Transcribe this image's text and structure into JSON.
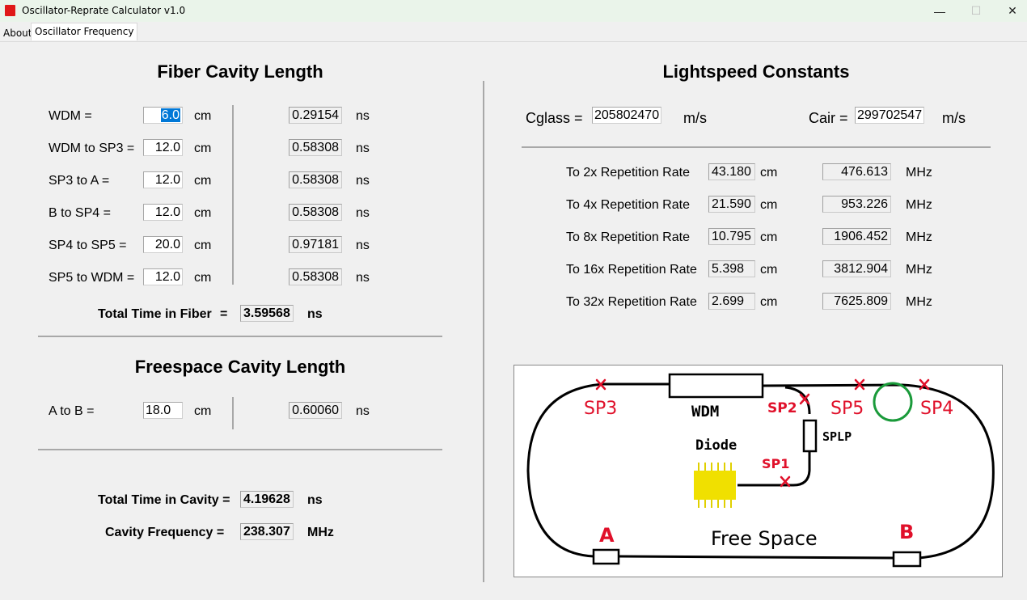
{
  "window": {
    "title": "Oscillator-Reprate Calculator v1.0",
    "minimize": "—",
    "maximize": "☐",
    "close": "✕"
  },
  "tabs": {
    "about": "About",
    "oscillator": "Oscillator Frequency"
  },
  "fiber": {
    "heading": "Fiber Cavity Length",
    "rows": [
      {
        "label": "WDM =",
        "value": "6.0",
        "unit": "cm",
        "time": "0.29154",
        "time_unit": "ns"
      },
      {
        "label": "WDM to SP3 =",
        "value": "12.0",
        "unit": "cm",
        "time": "0.58308",
        "time_unit": "ns"
      },
      {
        "label": "SP3 to A =",
        "value": "12.0",
        "unit": "cm",
        "time": "0.58308",
        "time_unit": "ns"
      },
      {
        "label": "B to SP4 =",
        "value": "12.0",
        "unit": "cm",
        "time": "0.58308",
        "time_unit": "ns"
      },
      {
        "label": "SP4 to SP5 =",
        "value": "20.0",
        "unit": "cm",
        "time": "0.97181",
        "time_unit": "ns"
      },
      {
        "label": "SP5 to WDM =",
        "value": "12.0",
        "unit": "cm",
        "time": "0.58308",
        "time_unit": "ns"
      }
    ],
    "total_label": "Total Time in Fiber",
    "total_eq": "=",
    "total_value": "3.59568",
    "total_unit": "ns"
  },
  "freespace": {
    "heading": "Freespace Cavity Length",
    "row": {
      "label": "A to B =",
      "value": "18.0",
      "unit": "cm",
      "time": "0.60060",
      "time_unit": "ns"
    }
  },
  "cavity": {
    "total_label": "Total Time in Cavity =",
    "total_value": "4.19628",
    "total_unit": "ns",
    "freq_label": "Cavity Frequency =",
    "freq_value": "238.307",
    "freq_unit": "MHz"
  },
  "lightspeed": {
    "heading": "Lightspeed Constants",
    "cglass_label": "Cglass =",
    "cglass_value": "205802470",
    "cglass_unit": "m/s",
    "cair_label": "Cair =",
    "cair_value": "299702547",
    "cair_unit": "m/s"
  },
  "reprates": [
    {
      "label": "To 2x Repetition Rate",
      "length": "43.180",
      "length_unit": "cm",
      "freq": "476.613",
      "freq_unit": "MHz"
    },
    {
      "label": "To 4x Repetition Rate",
      "length": "21.590",
      "length_unit": "cm",
      "freq": "953.226",
      "freq_unit": "MHz"
    },
    {
      "label": "To 8x Repetition Rate",
      "length": "10.795",
      "length_unit": "cm",
      "freq": "1906.452",
      "freq_unit": "MHz"
    },
    {
      "label": "To 16x Repetition Rate",
      "length": "5.398",
      "length_unit": "cm",
      "freq": "3812.904",
      "freq_unit": "MHz"
    },
    {
      "label": "To 32x Repetition Rate",
      "length": "2.699",
      "length_unit": "cm",
      "freq": "7625.809",
      "freq_unit": "MHz"
    }
  ],
  "diagram": {
    "labels": {
      "sp3": "SP3",
      "wdm": "WDM",
      "sp2": "SP2",
      "sp5": "SP5",
      "sp4": "SP4",
      "splp": "SPLP",
      "diode": "Diode",
      "sp1": "SP1",
      "a": "A",
      "b": "B",
      "freespace": "Free Space"
    },
    "colors": {
      "ink": "#000000",
      "marker": "#e0102a",
      "diode": "#f0e000",
      "circle": "#1a9a3a"
    }
  }
}
